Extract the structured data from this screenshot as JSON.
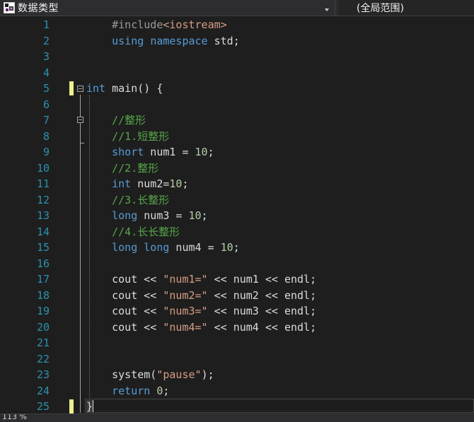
{
  "navbar": {
    "scope_icon": "class-icon",
    "scope_label": "数据类型",
    "member_label": "(全局范围)"
  },
  "editor": {
    "lines": [
      {
        "num": "1",
        "tokens": [
          [
            "    ",
            "plain"
          ],
          [
            "#include",
            "preproc"
          ],
          [
            "<iostream>",
            "include"
          ]
        ]
      },
      {
        "num": "2",
        "tokens": [
          [
            "    ",
            "plain"
          ],
          [
            "using",
            "keyword"
          ],
          [
            " ",
            "plain"
          ],
          [
            "namespace",
            "keyword"
          ],
          [
            " std;",
            "plain"
          ]
        ]
      },
      {
        "num": "3",
        "tokens": []
      },
      {
        "num": "4",
        "tokens": []
      },
      {
        "num": "5",
        "tokens": [
          [
            "int",
            "keyword"
          ],
          [
            " main() {",
            "plain"
          ]
        ]
      },
      {
        "num": "6",
        "tokens": []
      },
      {
        "num": "7",
        "tokens": [
          [
            "    ",
            "plain"
          ],
          [
            "//整形",
            "comment"
          ]
        ]
      },
      {
        "num": "8",
        "tokens": [
          [
            "    ",
            "plain"
          ],
          [
            "//1.短整形",
            "comment"
          ]
        ]
      },
      {
        "num": "9",
        "tokens": [
          [
            "    ",
            "plain"
          ],
          [
            "short",
            "keyword"
          ],
          [
            " num1 = ",
            "plain"
          ],
          [
            "10",
            "number"
          ],
          [
            ";",
            "plain"
          ]
        ]
      },
      {
        "num": "10",
        "tokens": [
          [
            "    ",
            "plain"
          ],
          [
            "//2.整形",
            "comment"
          ]
        ]
      },
      {
        "num": "11",
        "tokens": [
          [
            "    ",
            "plain"
          ],
          [
            "int",
            "keyword"
          ],
          [
            " num2=",
            "plain"
          ],
          [
            "10",
            "number"
          ],
          [
            ";",
            "plain"
          ]
        ]
      },
      {
        "num": "12",
        "tokens": [
          [
            "    ",
            "plain"
          ],
          [
            "//3.长整形",
            "comment"
          ]
        ]
      },
      {
        "num": "13",
        "tokens": [
          [
            "    ",
            "plain"
          ],
          [
            "long",
            "keyword"
          ],
          [
            " num3 = ",
            "plain"
          ],
          [
            "10",
            "number"
          ],
          [
            ";",
            "plain"
          ]
        ]
      },
      {
        "num": "14",
        "tokens": [
          [
            "    ",
            "plain"
          ],
          [
            "//4.长长整形",
            "comment"
          ]
        ]
      },
      {
        "num": "15",
        "tokens": [
          [
            "    ",
            "plain"
          ],
          [
            "long",
            "keyword"
          ],
          [
            " ",
            "plain"
          ],
          [
            "long",
            "keyword"
          ],
          [
            " num4 = ",
            "plain"
          ],
          [
            "10",
            "number"
          ],
          [
            ";",
            "plain"
          ]
        ]
      },
      {
        "num": "16",
        "tokens": []
      },
      {
        "num": "17",
        "tokens": [
          [
            "    ",
            "plain"
          ],
          [
            "cout << ",
            "plain"
          ],
          [
            "\"num1=\"",
            "string"
          ],
          [
            " << num1 << endl;",
            "plain"
          ]
        ]
      },
      {
        "num": "18",
        "tokens": [
          [
            "    ",
            "plain"
          ],
          [
            "cout << ",
            "plain"
          ],
          [
            "\"num2=\"",
            "string"
          ],
          [
            " << num2 << endl;",
            "plain"
          ]
        ]
      },
      {
        "num": "19",
        "tokens": [
          [
            "    ",
            "plain"
          ],
          [
            "cout << ",
            "plain"
          ],
          [
            "\"num3=\"",
            "string"
          ],
          [
            " << num3 << endl;",
            "plain"
          ]
        ]
      },
      {
        "num": "20",
        "tokens": [
          [
            "    ",
            "plain"
          ],
          [
            "cout << ",
            "plain"
          ],
          [
            "\"num4=\"",
            "string"
          ],
          [
            " << num4 << endl;",
            "plain"
          ]
        ]
      },
      {
        "num": "21",
        "tokens": []
      },
      {
        "num": "22",
        "tokens": []
      },
      {
        "num": "23",
        "tokens": [
          [
            "    ",
            "plain"
          ],
          [
            "system(",
            "plain"
          ],
          [
            "\"pause\"",
            "string"
          ],
          [
            ");",
            "plain"
          ]
        ]
      },
      {
        "num": "24",
        "tokens": [
          [
            "    ",
            "plain"
          ],
          [
            "return",
            "keyword"
          ],
          [
            " ",
            "plain"
          ],
          [
            "0",
            "number"
          ],
          [
            ";",
            "plain"
          ]
        ]
      },
      {
        "num": "25",
        "tokens": [
          [
            "}",
            "plain"
          ]
        ]
      }
    ],
    "changed_lines": [
      "5",
      "25"
    ],
    "current_line": "25"
  },
  "statusbar": {
    "zoom_label": "113 %"
  },
  "colors": {
    "line_number": "#2b91af",
    "keyword": "#569cd6",
    "number": "#b5cea8",
    "string": "#d69d85",
    "comment": "#57a64a",
    "preprocessor": "#9b9b9b",
    "change_marker": "#efef91",
    "background": "#1e1e1e"
  }
}
